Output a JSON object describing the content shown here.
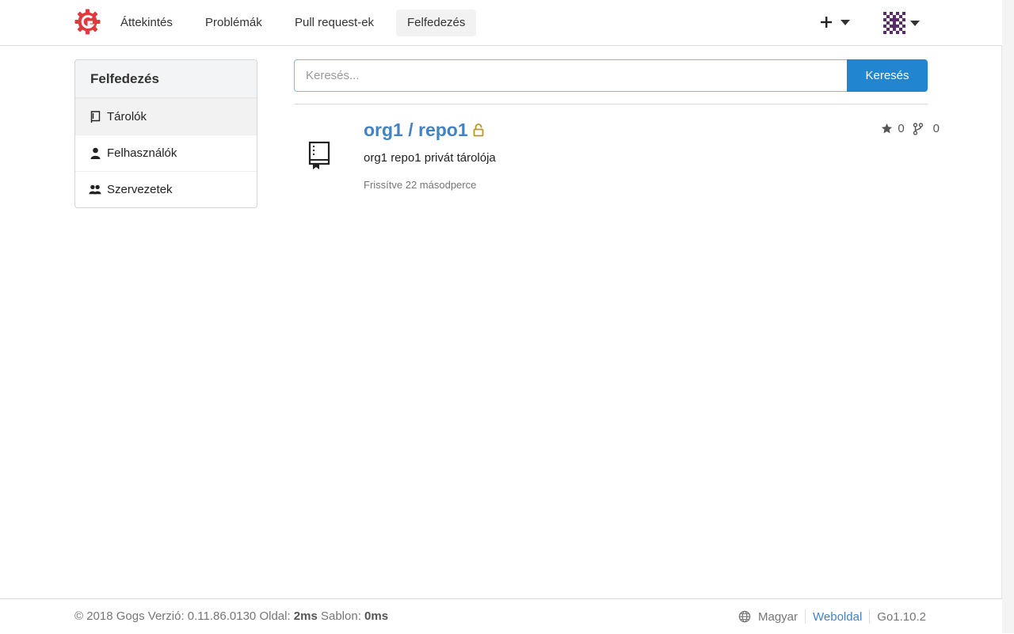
{
  "nav": {
    "items": [
      {
        "label": "Áttekintés"
      },
      {
        "label": "Problémák"
      },
      {
        "label": "Pull request-ek"
      },
      {
        "label": "Felfedezés"
      }
    ],
    "plus_label": "+"
  },
  "sidebar": {
    "header": "Felfedezés",
    "items": [
      {
        "label": "Tárolók",
        "icon": "repo-icon"
      },
      {
        "label": "Felhasználók",
        "icon": "person-icon"
      },
      {
        "label": "Szervezetek",
        "icon": "organization-icon"
      }
    ]
  },
  "search": {
    "placeholder": "Keresés...",
    "value": "",
    "button_label": "Keresés"
  },
  "repo": {
    "title": "org1 / repo1",
    "description": "org1 repo1 privát tárolója",
    "updated": "Frissítve 22 másodperce",
    "stars": "0",
    "forks": "0",
    "private": true
  },
  "footer": {
    "copyright_prefix": "© 2018 Gogs Verzió: 0.11.86.0130 Oldal: ",
    "page_time": "2ms",
    "template_label": " Sablon: ",
    "template_time": "0ms",
    "language": "Magyar",
    "website": "Weboldal",
    "go_version": "Go1.10.2"
  },
  "colors": {
    "accent": "#2185d0",
    "link": "#4183c4",
    "logo": "#e0393e",
    "lock": "#b59a1f"
  }
}
